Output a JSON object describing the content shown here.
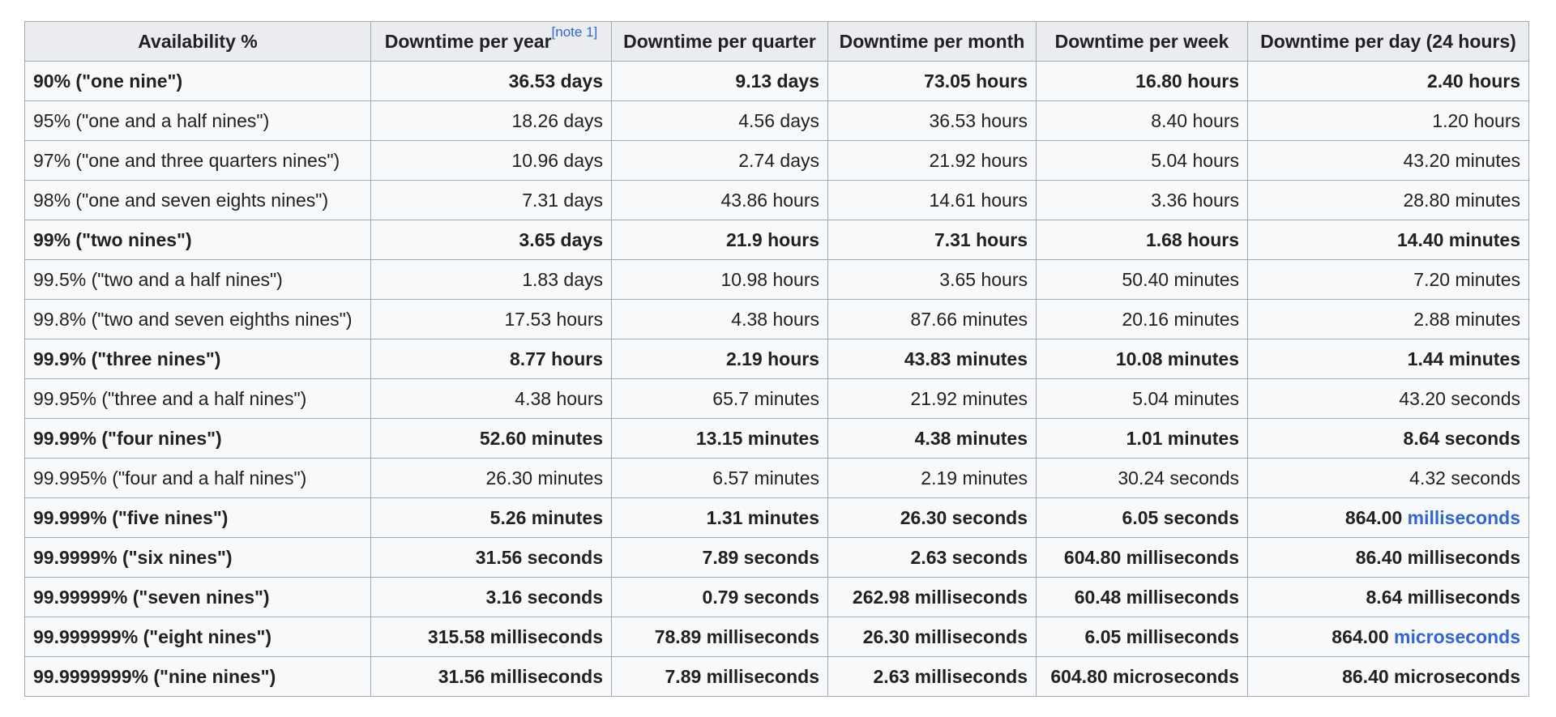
{
  "headers": [
    "Availability %",
    "Downtime per year",
    "Downtime per quarter",
    "Downtime per month",
    "Downtime per week",
    "Downtime per day (24 hours)"
  ],
  "header_note": "[note 1]",
  "rows": [
    {
      "bold": true,
      "cells": [
        "90% (\"one nine\")",
        "36.53 days",
        "9.13 days",
        "73.05 hours",
        "16.80 hours",
        "2.40 hours"
      ]
    },
    {
      "bold": false,
      "cells": [
        "95% (\"one and a half nines\")",
        "18.26 days",
        "4.56 days",
        "36.53 hours",
        "8.40 hours",
        "1.20 hours"
      ]
    },
    {
      "bold": false,
      "cells": [
        "97% (\"one and three quarters nines\")",
        "10.96 days",
        "2.74 days",
        "21.92 hours",
        "5.04 hours",
        "43.20 minutes"
      ]
    },
    {
      "bold": false,
      "cells": [
        "98% (\"one and seven eights nines\")",
        "7.31 days",
        "43.86 hours",
        "14.61 hours",
        "3.36 hours",
        "28.80 minutes"
      ]
    },
    {
      "bold": true,
      "cells": [
        "99% (\"two nines\")",
        "3.65 days",
        "21.9 hours",
        "7.31 hours",
        "1.68 hours",
        "14.40 minutes"
      ]
    },
    {
      "bold": false,
      "cells": [
        "99.5% (\"two and a half nines\")",
        "1.83 days",
        "10.98 hours",
        "3.65 hours",
        "50.40 minutes",
        "7.20 minutes"
      ]
    },
    {
      "bold": false,
      "cells": [
        "99.8% (\"two and seven eighths nines\")",
        "17.53 hours",
        "4.38 hours",
        "87.66 minutes",
        "20.16 minutes",
        "2.88 minutes"
      ]
    },
    {
      "bold": true,
      "cells": [
        "99.9% (\"three nines\")",
        "8.77 hours",
        "2.19 hours",
        "43.83 minutes",
        "10.08 minutes",
        "1.44 minutes"
      ]
    },
    {
      "bold": false,
      "cells": [
        "99.95% (\"three and a half nines\")",
        "4.38 hours",
        "65.7 minutes",
        "21.92 minutes",
        "5.04 minutes",
        "43.20 seconds"
      ]
    },
    {
      "bold": true,
      "cells": [
        "99.99% (\"four nines\")",
        "52.60 minutes",
        "13.15 minutes",
        "4.38 minutes",
        "1.01 minutes",
        "8.64 seconds"
      ]
    },
    {
      "bold": false,
      "cells": [
        "99.995% (\"four and a half nines\")",
        "26.30 minutes",
        "6.57 minutes",
        "2.19 minutes",
        "30.24 seconds",
        "4.32 seconds"
      ]
    },
    {
      "bold": true,
      "cells": [
        "99.999% (\"five nines\")",
        "5.26 minutes",
        "1.31 minutes",
        "26.30 seconds",
        "6.05 seconds",
        "864.00 milliseconds"
      ],
      "last_link": {
        "num": "864.00 ",
        "unit": "milliseconds"
      }
    },
    {
      "bold": true,
      "cells": [
        "99.9999% (\"six nines\")",
        "31.56 seconds",
        "7.89 seconds",
        "2.63 seconds",
        "604.80 milliseconds",
        "86.40 milliseconds"
      ]
    },
    {
      "bold": true,
      "cells": [
        "99.99999% (\"seven nines\")",
        "3.16 seconds",
        "0.79 seconds",
        "262.98 milliseconds",
        "60.48 milliseconds",
        "8.64 milliseconds"
      ]
    },
    {
      "bold": true,
      "cells": [
        "99.999999% (\"eight nines\")",
        "315.58 milliseconds",
        "78.89 milliseconds",
        "26.30 milliseconds",
        "6.05 milliseconds",
        "864.00 microseconds"
      ],
      "last_link": {
        "num": "864.00 ",
        "unit": "microseconds"
      }
    },
    {
      "bold": true,
      "cells": [
        "99.9999999% (\"nine nines\")",
        "31.56 milliseconds",
        "7.89 milliseconds",
        "2.63 milliseconds",
        "604.80 microseconds",
        "86.40 microseconds"
      ]
    }
  ],
  "colors": {
    "link": "#3366cc",
    "header_bg": "#eaecf0",
    "cell_bg": "#f8f9fa",
    "border": "#a2a9b1"
  }
}
